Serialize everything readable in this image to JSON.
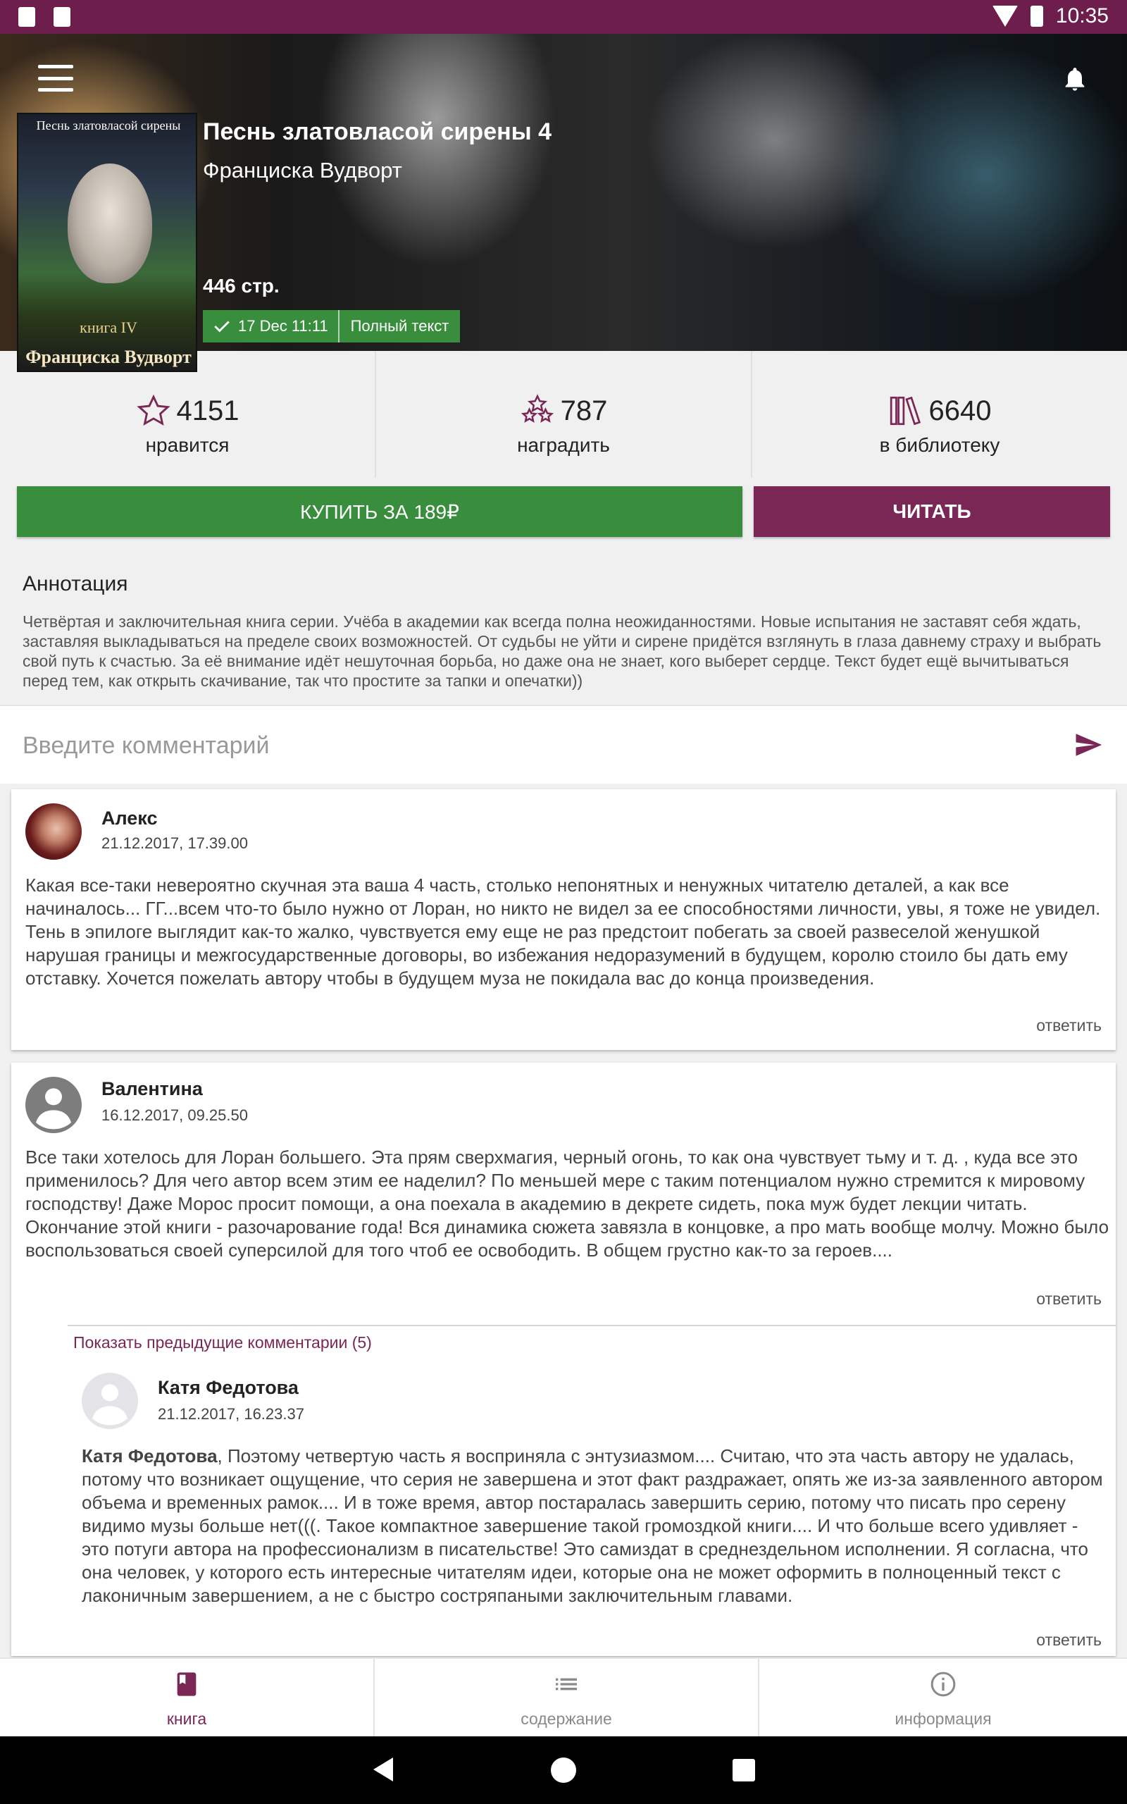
{
  "status_bar": {
    "time": "10:35"
  },
  "book": {
    "title": "Песнь златовласой сирены 4",
    "author": "Франциска Вудворт",
    "pages": "446 стр.",
    "updated": "17 Dec 11:11",
    "status": "Полный текст",
    "cover": {
      "title": "Песнь златовласой сирены",
      "book": "книга IV",
      "author": "Франциска Вудворт"
    }
  },
  "stats": [
    {
      "icon": "star-outline-icon",
      "count": "4151",
      "label": "нравится"
    },
    {
      "icon": "award-stars-icon",
      "count": "787",
      "label": "наградить"
    },
    {
      "icon": "library-books-icon",
      "count": "6640",
      "label": "в библиотеку"
    }
  ],
  "buttons": {
    "buy": "КУПИТЬ ЗА 189₽",
    "read": "ЧИТАТЬ"
  },
  "annotation": {
    "title": "Аннотация",
    "text": "Четвёртая и заключительная книга серии. Учёба в академии как всегда полна неожиданностями. Новые испытания не заставят себя ждать, заставляя выкладываться на пределе своих возможностей. От судьбы не уйти и сирене придётся взглянуть в глаза давнему страху и выбрать свой путь к счастью. За её внимание идёт нешуточная борьба, но даже она не знает, кого выберет сердце. Текст будет ещё вычитываться перед тем, как открыть скачивание, так что простите за тапки и опечатки))"
  },
  "comment_input": {
    "placeholder": "Введите комментарий"
  },
  "comments": [
    {
      "author": "Алекс",
      "date": "21.12.2017, 17.39.00",
      "text": "Какая все-таки невероятно скучная эта ваша 4 часть, столько непонятных и ненужных читателю деталей, а как все начиналось... ГГ...всем что-то было нужно от Лоран, но никто не видел за ее способностями личности, увы, я тоже не увидел. Тень в эпилоге выглядит как-то жалко, чувствуется ему еще не раз предстоит побегать за своей развеселой женушкой нарушая границы и межгосударственные договоры, во избежания недоразумений в будущем, королю стоило бы дать ему отставку. Хочется пожелать автору чтобы в будущем муза не покидала вас до конца произведения.",
      "reply": "ответить"
    },
    {
      "author": "Валентина",
      "date": "16.12.2017, 09.25.50",
      "text": "Все таки хотелось для Лоран большего. Эта прям сверхмагия, черный огонь, то как она чувствует тьму и т. д. , куда все это применилось?  Для чего автор всем этим ее наделил?  По меньшей мере с таким потенциалом нужно стремится к мировому господству!  Даже Морос просит помощи, а она поехала в академию в декрете сидеть, пока муж будет лекции читать. Окончание этой книги - разочарование года!  Вся динамика сюжета завязла в концовке, а про мать вообще молчу. Можно было воспользоваться своей суперсилой для того чтоб ее освободить. В общем грустно как-то за героев....",
      "reply": "ответить",
      "show_previous": "Показать предыдущие комментарии (5)",
      "replies": [
        {
          "author": "Катя Федотова",
          "date": "21.12.2017, 16.23.37",
          "mention": "Катя Федотова",
          "text": ", Поэтому четвертую часть я восприняла с энтузиазмом.... Считаю, что эта часть автору не удалась, потому что возникает ощущение, что серия не завершена и этот факт раздражает, опять же из-за заявленного автором объема и временных рамок.... И в тоже время, автор постаралась завершить серию, потому что писать про серену видимо музы больше нет(((. Такое компактное завершение такой громоздкой книги.... И что больше всего удивляет - это потуги автора на профессионализм в писательстве! Это самиздат в среднездельном исполнении. Я согласна, что она человек, у которого есть интересные читателям идеи, которые она не может оформить в полноценный текст с лаконичным завершением, а не с быстро состряпаными заключительным главами.",
          "reply": "ответить"
        }
      ]
    }
  ],
  "bottom_nav": [
    {
      "icon": "book-icon",
      "label": "книга",
      "active": true
    },
    {
      "icon": "list-icon",
      "label": "содержание",
      "active": false
    },
    {
      "icon": "info-icon",
      "label": "информация",
      "active": false
    }
  ],
  "colors": {
    "primary": "#6e1e4c",
    "accent": "#7b2755",
    "buy": "#388e3c",
    "nav_inactive": "#8a8a8a"
  }
}
